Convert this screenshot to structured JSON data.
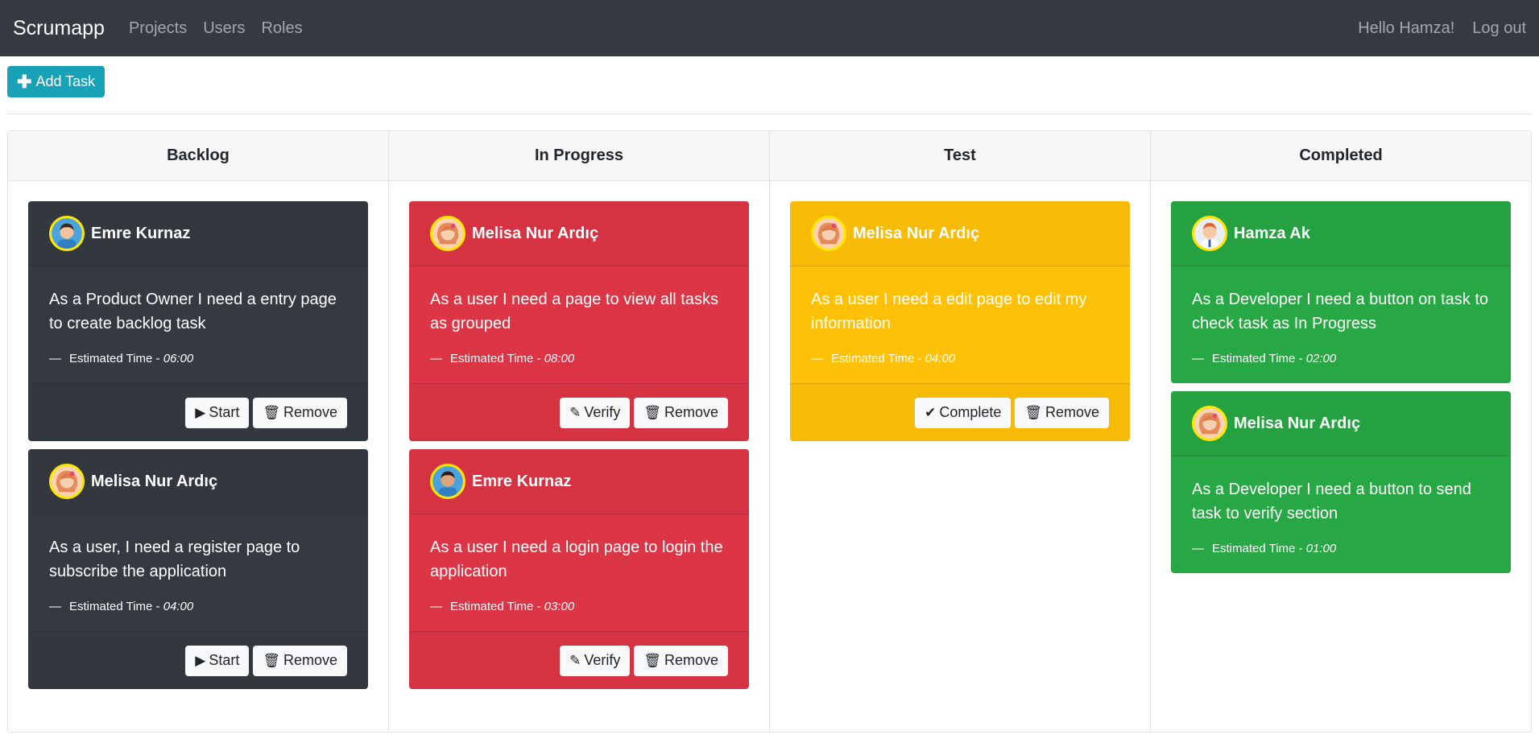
{
  "navbar": {
    "brand": "Scrumapp",
    "links": [
      "Projects",
      "Users",
      "Roles"
    ],
    "greeting": "Hello Hamza!",
    "logout": "Log out"
  },
  "toolbar": {
    "add_task_label": "Add Task"
  },
  "est_label": "Estimated Time - ",
  "columns": [
    {
      "title": "Backlog",
      "cards": [
        {
          "name": "Emre Kurnaz",
          "desc": "As a Product Owner I need a entry page to create backlog task",
          "time": "06:00",
          "action": "Start",
          "remove": "Remove"
        },
        {
          "name": "Melisa Nur Ardıç",
          "desc": "As a user, I need a register page to subscribe the application",
          "time": "04:00",
          "action": "Start",
          "remove": "Remove"
        }
      ]
    },
    {
      "title": "In Progress",
      "cards": [
        {
          "name": "Melisa Nur Ardıç",
          "desc": "As a user I need a page to view all tasks as grouped",
          "time": "08:00",
          "action": "Verify",
          "remove": "Remove"
        },
        {
          "name": "Emre Kurnaz",
          "desc": "As a user I need a login page to login the application",
          "time": "03:00",
          "action": "Verify",
          "remove": "Remove"
        }
      ]
    },
    {
      "title": "Test",
      "cards": [
        {
          "name": "Melisa Nur Ardıç",
          "desc": "As a user I need a edit page to edit my information",
          "time": "04:00",
          "action": "Complete",
          "remove": "Remove"
        }
      ]
    },
    {
      "title": "Completed",
      "cards": [
        {
          "name": "Hamza Ak",
          "desc": "As a Developer I need a button on task to check task as In Progress",
          "time": "02:00"
        },
        {
          "name": "Melisa Nur Ardıç",
          "desc": "As a Developer I need a button to send task to verify section",
          "time": "01:00"
        }
      ]
    }
  ],
  "colors": {
    "backlog": "#343a40",
    "in_progress": "#dc3545",
    "test": "#ffc107",
    "completed": "#28a745",
    "accent": "#17a2b8"
  },
  "icons": {
    "add": "plus-icon",
    "start": "play-icon",
    "verify": "pencil-icon",
    "complete": "check-icon",
    "remove": "trash-icon"
  }
}
